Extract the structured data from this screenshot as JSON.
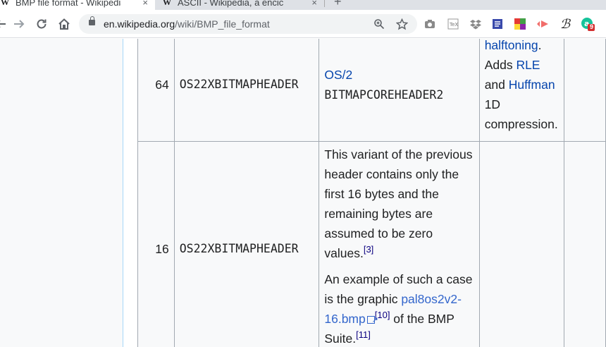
{
  "browser": {
    "tabs": [
      {
        "favicon": "W",
        "title": "BMP file format - Wikipedia",
        "active": true
      },
      {
        "favicon": "W",
        "title": "ASCII - Wikipedia, a encic",
        "active": false
      }
    ],
    "tab_close": "×",
    "new_tab": "+",
    "url_host": "en.wikipedia.org",
    "url_path": "/wiki/BMP_file_format",
    "extensions": [
      "camera-icon",
      "tex-icon",
      "dropbox-icon",
      "notes-icon",
      "color-grid-icon",
      "cast-icon",
      "beta-icon",
      "grammarly-icon"
    ],
    "badge_count": "9"
  },
  "table": {
    "row1": {
      "size": "64",
      "name": "OS22XBITMAPHEADER",
      "os_link": "OS/2",
      "os_struct": "BITMAPCOREHEADER2",
      "notes": {
        "link1": "halftoning",
        "after1": ".",
        "text2": "Adds ",
        "link2": "RLE",
        "text3": "and ",
        "link3": "Huffman",
        "text4": "1D",
        "text5": "compression."
      }
    },
    "row2": {
      "size": "16",
      "name": "OS22XBITMAPHEADER",
      "para1": "This variant of the previous header contains only the first 16 bytes and the remaining bytes are assumed to be zero values.",
      "ref1": "[3]",
      "para2_start": "An example of such a case is the graphic ",
      "para2_link": "pal8os2v2-16.bmp",
      "ref2": "[10]",
      "para2_end": " of the BMP Suite.",
      "ref3": "[11]"
    }
  }
}
